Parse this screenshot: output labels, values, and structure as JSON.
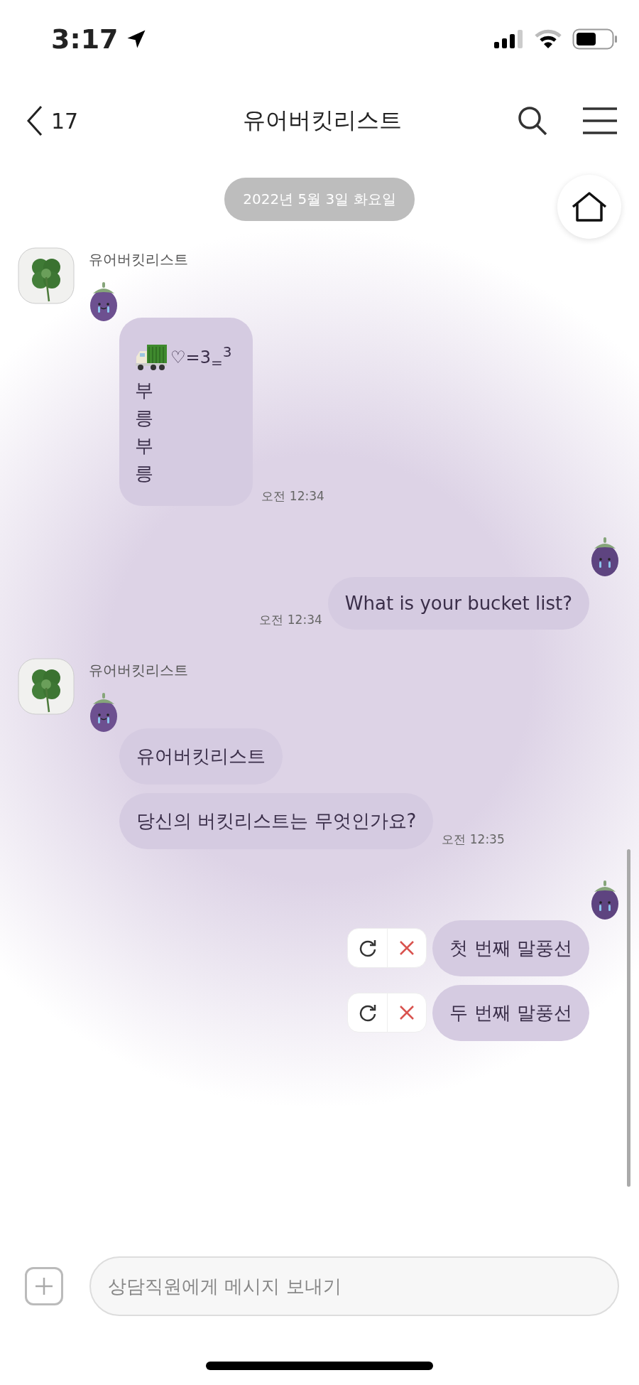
{
  "status_bar": {
    "time": "3:17"
  },
  "header": {
    "back_count": "17",
    "title": "유어버킷리스트"
  },
  "date_divider": "2022년 5월 3일 화요일",
  "messages": [
    {
      "kind": "incoming",
      "sender": "유어버킷리스트",
      "time": "오전 12:34",
      "bubbles": [
        {
          "kind": "sticker_text",
          "text": "♡=3$_{=}$$^{3}$",
          "vertical_text": "부릉부릉"
        }
      ]
    },
    {
      "kind": "outgoing",
      "time": "오전 12:34",
      "bubbles": [
        {
          "kind": "text",
          "text": "What is your bucket list?",
          "failed": false
        }
      ]
    },
    {
      "kind": "incoming",
      "sender": "유어버킷리스트",
      "time": "오전 12:35",
      "bubbles": [
        {
          "kind": "text",
          "text": "유어버킷리스트"
        },
        {
          "kind": "text",
          "text": "당신의 버킷리스트는 무엇인가요?"
        }
      ]
    },
    {
      "kind": "outgoing",
      "bubbles": [
        {
          "kind": "text",
          "text": "첫 번째 말풍선",
          "failed": true
        },
        {
          "kind": "text",
          "text": "두 번째 말풍선",
          "failed": true
        }
      ]
    }
  ],
  "composer": {
    "placeholder": "상담직원에게 메시지 보내기"
  }
}
